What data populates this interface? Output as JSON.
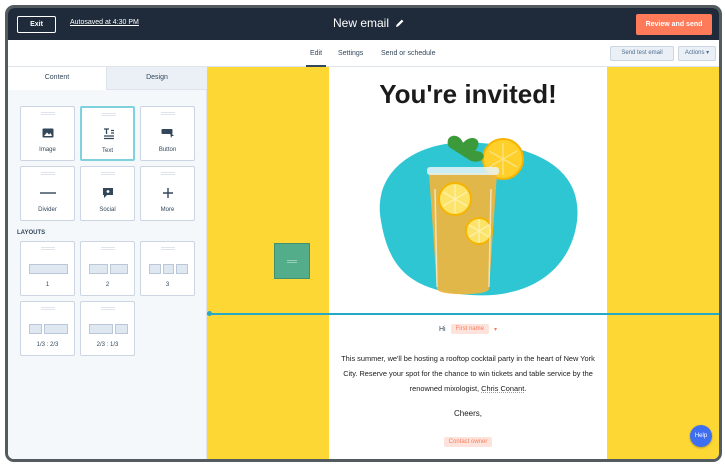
{
  "topbar": {
    "exit_label": "Exit",
    "autosave_text": "Autosaved at 4:30 PM",
    "email_title": "New email",
    "review_label": "Review and send"
  },
  "subnav": {
    "tabs": [
      {
        "label": "Edit",
        "active": true
      },
      {
        "label": "Settings",
        "active": false
      },
      {
        "label": "Send or schedule",
        "active": false
      }
    ],
    "send_test_label": "Send test email",
    "actions_label": "Actions ▾"
  },
  "leftpanel": {
    "tabs": [
      {
        "label": "Content",
        "active": true
      },
      {
        "label": "Design",
        "active": false
      }
    ],
    "modules": [
      {
        "label": "Image",
        "icon": "image-icon"
      },
      {
        "label": "Text",
        "icon": "text-icon",
        "selected": true
      },
      {
        "label": "Button",
        "icon": "button-icon"
      },
      {
        "label": "Divider",
        "icon": "divider-icon"
      },
      {
        "label": "Social",
        "icon": "social-icon"
      },
      {
        "label": "More",
        "icon": "plus-icon"
      }
    ],
    "layouts_heading": "LAYOUTS",
    "layouts": [
      {
        "label": "1"
      },
      {
        "label": "2"
      },
      {
        "label": "3"
      },
      {
        "label": "1/3 : 2/3"
      },
      {
        "label": "2/3 : 1/3"
      }
    ]
  },
  "email": {
    "heading": "You're invited!",
    "greeting": "Hi",
    "first_name_token": "First name",
    "paragraph_before": "This summer, we'll be hosting a rooftop cocktail party in the heart of New York City. Reserve your spot for the chance to win tickets and table service by the renowned mixologist, ",
    "paragraph_name": "Chris Conant",
    "paragraph_after": ".",
    "signoff": "Cheers,",
    "owner_token": "Contact owner"
  },
  "help_label": "Help",
  "colors": {
    "topbar": "#1f2b3a",
    "accent": "#ff7a59",
    "canvas_bg": "#fdd835",
    "selection_line": "#27a8c6",
    "help": "#3e6ff1"
  }
}
